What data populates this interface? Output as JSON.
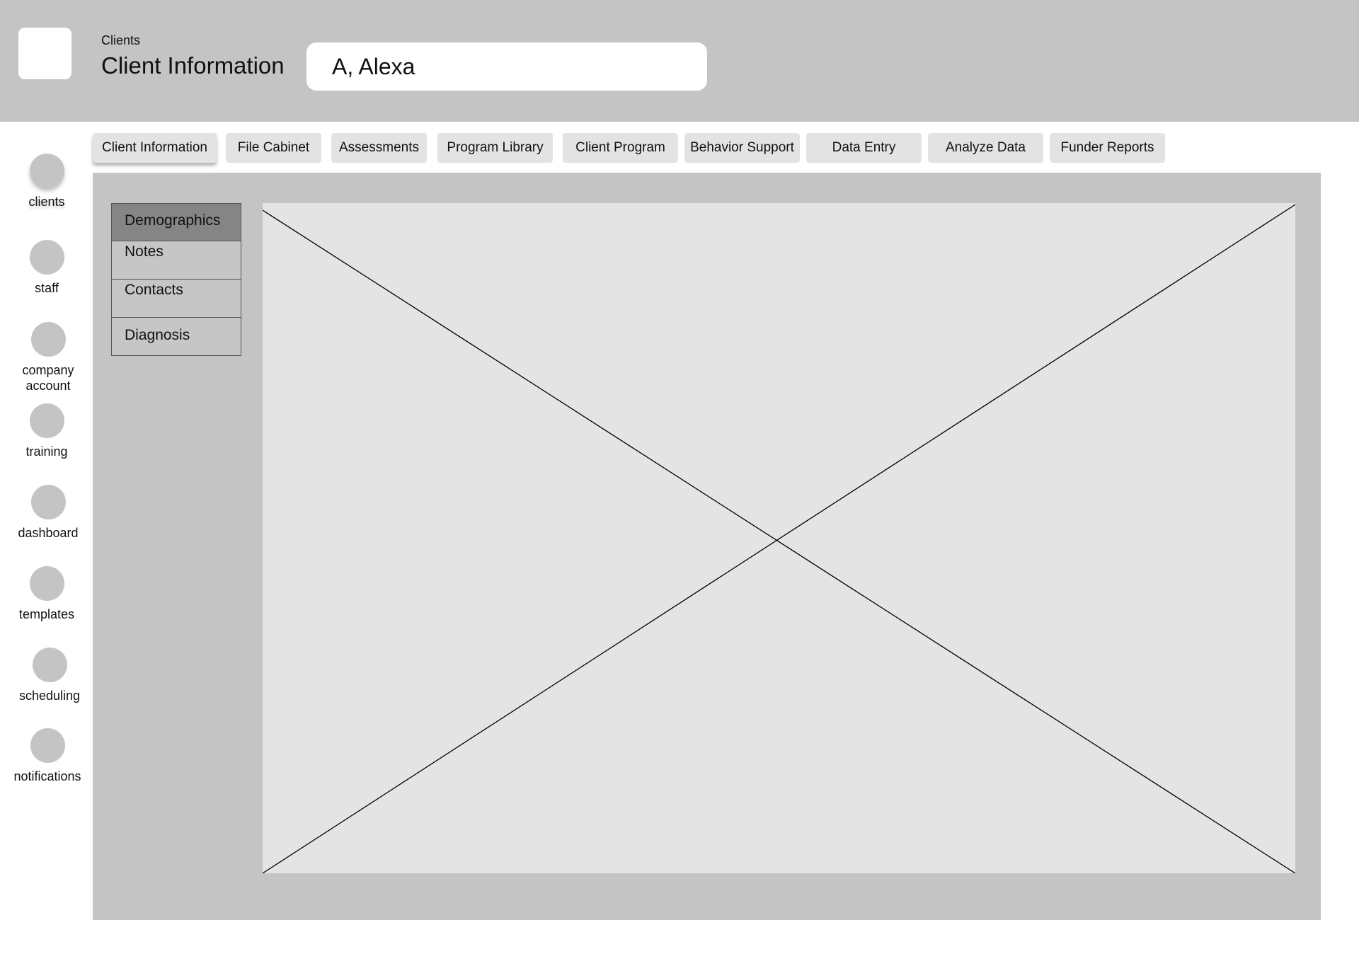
{
  "header": {
    "breadcrumb": "Clients",
    "title": "Client Information",
    "client_name": "A, Alexa"
  },
  "nav": {
    "items": [
      {
        "label": "clients"
      },
      {
        "label": "staff"
      },
      {
        "label": "company account"
      },
      {
        "label": "training"
      },
      {
        "label": "dashboard"
      },
      {
        "label": "templates"
      },
      {
        "label": "scheduling"
      },
      {
        "label": "notifications"
      }
    ]
  },
  "tabs": [
    {
      "label": "Client Information"
    },
    {
      "label": "File Cabinet"
    },
    {
      "label": "Assessments"
    },
    {
      "label": "Program Library"
    },
    {
      "label": "Client Program"
    },
    {
      "label": "Behavior Support"
    },
    {
      "label": "Data Entry"
    },
    {
      "label": "Analyze Data"
    },
    {
      "label": "Funder Reports"
    }
  ],
  "subnav": {
    "items": [
      {
        "label": "Demographics"
      },
      {
        "label": "Notes"
      },
      {
        "label": "Contacts"
      },
      {
        "label": "Diagnosis"
      }
    ]
  },
  "colors": {
    "header_bg": "#c4c4c4",
    "panel_bg": "#c4c4c4",
    "tab_bg": "#e3e3e3",
    "subnav_active_bg": "#858585",
    "placeholder_bg": "#e4e4e4"
  }
}
